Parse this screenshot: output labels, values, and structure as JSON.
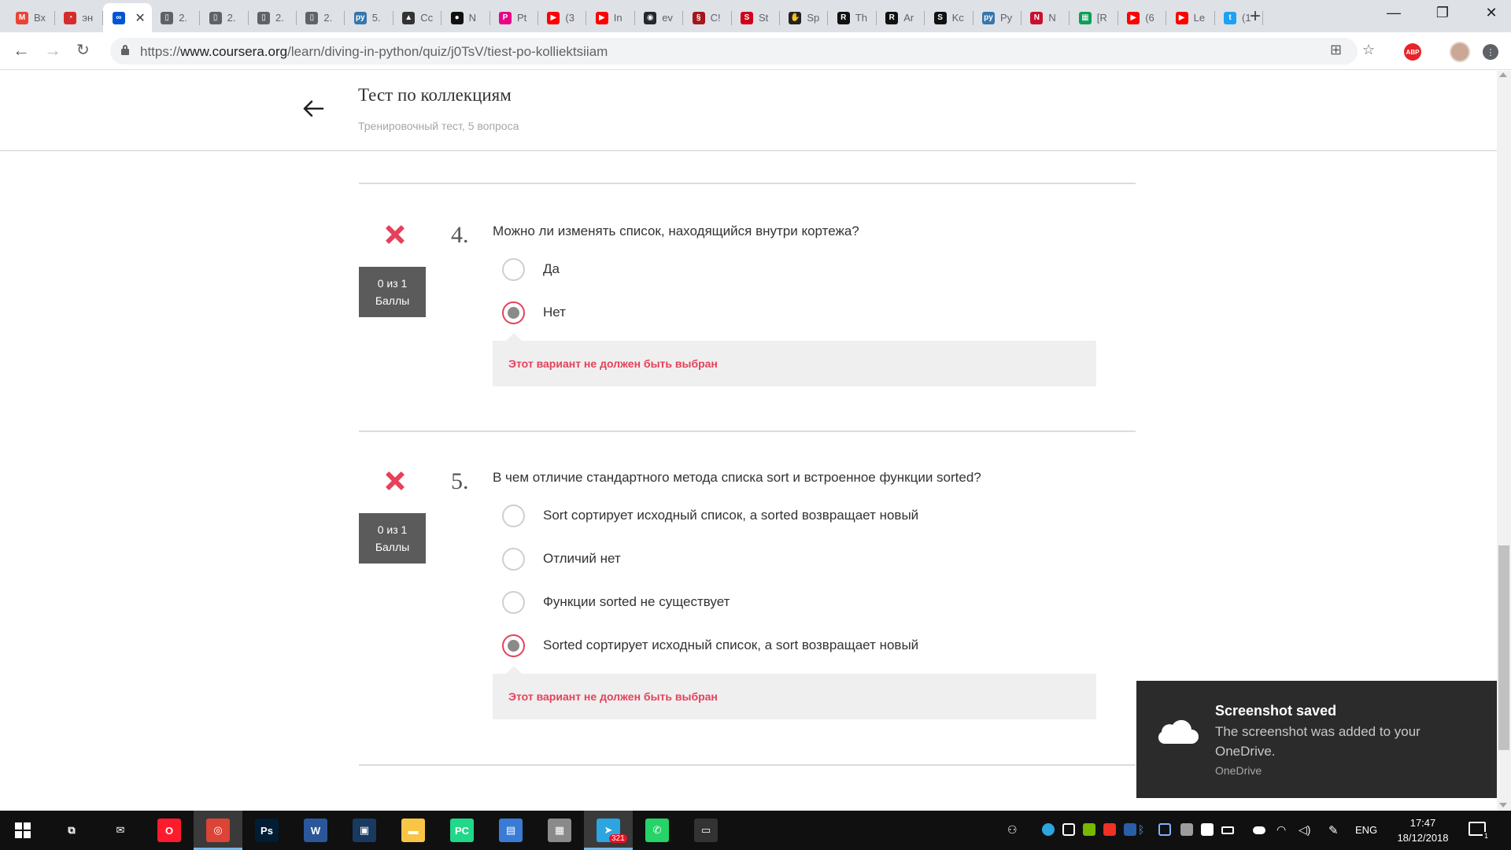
{
  "browser": {
    "tabs": [
      {
        "icon": "gmail-icon",
        "label": "Вх",
        "color": "#ea4335",
        "glyph": "M"
      },
      {
        "icon": "opera-dial-icon",
        "label": "эн",
        "color": "#d62b2b",
        "glyph": "◔"
      },
      {
        "icon": "coursera-icon",
        "label": "",
        "color": "#0056d2",
        "glyph": "∞",
        "active": true
      },
      {
        "icon": "document-icon",
        "label": "2.",
        "color": "#5f6368",
        "glyph": "▯"
      },
      {
        "icon": "document-icon",
        "label": "2.",
        "color": "#5f6368",
        "glyph": "▯"
      },
      {
        "icon": "document-icon",
        "label": "2.",
        "color": "#5f6368",
        "glyph": "▯"
      },
      {
        "icon": "document-icon",
        "label": "2.",
        "color": "#5f6368",
        "glyph": "▯"
      },
      {
        "icon": "python-icon",
        "label": "5.",
        "color": "#3776ab",
        "glyph": "py"
      },
      {
        "icon": "linux-icon",
        "label": "Cc",
        "color": "#333333",
        "glyph": "▲"
      },
      {
        "icon": "pin-icon",
        "label": "N",
        "color": "#111111",
        "glyph": "●"
      },
      {
        "icon": "pandas-icon",
        "label": "Pt",
        "color": "#e70488",
        "glyph": "P"
      },
      {
        "icon": "youtube-icon",
        "label": "(3",
        "color": "#ff0000",
        "glyph": "▶"
      },
      {
        "icon": "youtube-icon",
        "label": "In",
        "color": "#ff0000",
        "glyph": "▶"
      },
      {
        "icon": "github-icon",
        "label": "ev",
        "color": "#24292e",
        "glyph": "◉"
      },
      {
        "icon": "scrapy-icon",
        "label": "C!",
        "color": "#a4161a",
        "glyph": "§"
      },
      {
        "icon": "stepik-icon",
        "label": "St",
        "color": "#d0021b",
        "glyph": "S"
      },
      {
        "icon": "hand-icon",
        "label": "Sp",
        "color": "#222222",
        "glyph": "✋"
      },
      {
        "icon": "r-icon",
        "label": "Th",
        "color": "#111111",
        "glyph": "R"
      },
      {
        "icon": "r-icon",
        "label": "Ar",
        "color": "#111111",
        "glyph": "R"
      },
      {
        "icon": "s-icon",
        "label": "Kc",
        "color": "#111111",
        "glyph": "S"
      },
      {
        "icon": "python-icon",
        "label": "Py",
        "color": "#3776ab",
        "glyph": "py"
      },
      {
        "icon": "nba-icon",
        "label": "N",
        "color": "#c8102e",
        "glyph": "N"
      },
      {
        "icon": "sheets-icon",
        "label": "[R",
        "color": "#0f9d58",
        "glyph": "▦"
      },
      {
        "icon": "youtube-icon",
        "label": "(6",
        "color": "#ff0000",
        "glyph": "▶"
      },
      {
        "icon": "youtube-icon",
        "label": "Le",
        "color": "#ff0000",
        "glyph": "▶"
      },
      {
        "icon": "twitter-icon",
        "label": "(1",
        "color": "#1da1f2",
        "glyph": "t"
      }
    ],
    "tab_close": "✕",
    "new_tab": "+",
    "url_prefix": "https://",
    "url_host": "www.coursera.org",
    "url_path": "/learn/diving-in-python/quiz/j0TsV/tiest-po-kolliektsiiam",
    "window_controls": {
      "minimize": "—",
      "restore": "❐",
      "close": "✕"
    }
  },
  "header": {
    "title": "Тест по коллекциям",
    "subtitle": "Тренировочный тест, 5 вопроса"
  },
  "questions": [
    {
      "number": "4.",
      "text": "Можно ли изменять список, находящийся внутри кортежа?",
      "score_line1": "0 из 1",
      "score_line2": "Баллы",
      "options": [
        {
          "label": "Да",
          "selected": false
        },
        {
          "label": "Нет",
          "selected": true
        }
      ],
      "feedback": "Этот вариант не должен быть выбран"
    },
    {
      "number": "5.",
      "text": "В чем отличие стандартного метода списка sort и встроенное функции sorted?",
      "score_line1": "0 из 1",
      "score_line2": "Баллы",
      "options": [
        {
          "label": "Sort сортирует исходный список, а sorted возвращает новый",
          "selected": false
        },
        {
          "label": "Отличий нет",
          "selected": false
        },
        {
          "label": "Функции sorted не существует",
          "selected": false
        },
        {
          "label": "Sorted сортирует исходный список, а sort возвращает новый",
          "selected": true
        }
      ],
      "feedback": "Этот вариант не должен быть выбран"
    }
  ],
  "toast": {
    "title": "Screenshot saved",
    "body": "The screenshot was added to your OneDrive.",
    "source": "OneDrive"
  },
  "taskbar": {
    "apps": [
      {
        "name": "task-view-icon",
        "glyph": "⧉",
        "bg": "transparent"
      },
      {
        "name": "mail-icon",
        "glyph": "✉",
        "bg": "transparent"
      },
      {
        "name": "opera-icon",
        "glyph": "O",
        "bg": "#ff1b2d"
      },
      {
        "name": "chrome-icon",
        "glyph": "◎",
        "bg": "#db4437",
        "running": true
      },
      {
        "name": "photoshop-icon",
        "glyph": "Ps",
        "bg": "#001d34"
      },
      {
        "name": "word-icon",
        "glyph": "W",
        "bg": "#2b579a"
      },
      {
        "name": "virtualbox-icon",
        "glyph": "▣",
        "bg": "#183a61"
      },
      {
        "name": "file-explorer-icon",
        "glyph": "▬",
        "bg": "#f8c547"
      },
      {
        "name": "pycharm-icon",
        "glyph": "PC",
        "bg": "#21d789"
      },
      {
        "name": "control-panel-icon",
        "glyph": "▤",
        "bg": "#3a7bd5"
      },
      {
        "name": "installer-icon",
        "glyph": "▦",
        "bg": "#8a8a8a"
      },
      {
        "name": "telegram-icon",
        "glyph": "➤",
        "bg": "#2ca5e0",
        "running": true,
        "badge": "321"
      },
      {
        "name": "whatsapp-icon",
        "glyph": "✆",
        "bg": "#25d366"
      },
      {
        "name": "terminal-icon",
        "glyph": "▭",
        "bg": "#333333"
      }
    ],
    "language": "ENG",
    "time": "17:47",
    "date": "18/12/2018",
    "notifications": "1"
  }
}
